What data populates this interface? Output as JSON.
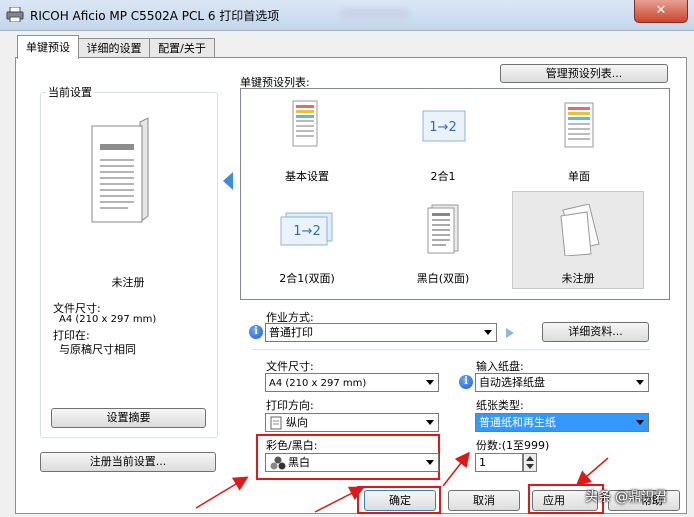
{
  "window": {
    "title": "RICOH Aficio MP C5502A PCL 6 打印首选项",
    "close_glyph": "✕"
  },
  "tabs": [
    {
      "label": "单键预设"
    },
    {
      "label": "详细的设置"
    },
    {
      "label": "配置/关于"
    }
  ],
  "current": {
    "group_label": "当前设置",
    "preset_name": "未注册",
    "doc_size_label": "文件尺寸:",
    "doc_size_value": "A4 (210 x 297 mm)",
    "print_on_label": "打印在:",
    "print_on_value": "与原稿尺寸相同",
    "summary_button": "设置摘要",
    "register_button": "注册当前设置..."
  },
  "presets": {
    "list_label": "单键预设列表:",
    "manage_button": "管理预设列表...",
    "items": [
      {
        "label": "基本设置",
        "icon": "color-document-icon"
      },
      {
        "label": "2合1",
        "icon": "two-in-one-icon",
        "glyph": "1→2"
      },
      {
        "label": "单面",
        "icon": "color-document-icon"
      },
      {
        "label": "2合1(双面)",
        "icon": "two-in-one-duplex-icon",
        "glyph": "1→2"
      },
      {
        "label": "黑白(双面)",
        "icon": "bw-document-icon"
      },
      {
        "label": "未注册",
        "icon": "blank-pages-icon"
      }
    ]
  },
  "job": {
    "label": "作业方式:",
    "value": "普通打印",
    "details_button": "详细资料..."
  },
  "settings": {
    "doc_size_label": "文件尺寸:",
    "doc_size_value": "A4 (210 x 297 mm)",
    "orientation_label": "打印方向:",
    "orientation_value": "纵向",
    "color_label": "彩色/黑白:",
    "color_value": "黑白",
    "input_tray_label": "输入纸盘:",
    "input_tray_value": "自动选择纸盘",
    "paper_type_label": "纸张类型:",
    "paper_type_value": "普通纸和再生纸",
    "copies_label": "份数:(1至999)",
    "copies_value": "1"
  },
  "footer": {
    "ok": "确定",
    "cancel": "取消",
    "apply": "应用",
    "help": "帮助",
    "watermark": "头条 @鼎识君"
  },
  "colors": {
    "highlight_red": "#e01818",
    "selection_blue": "#3399ff",
    "arrow_blue": "#3a8fd8"
  }
}
